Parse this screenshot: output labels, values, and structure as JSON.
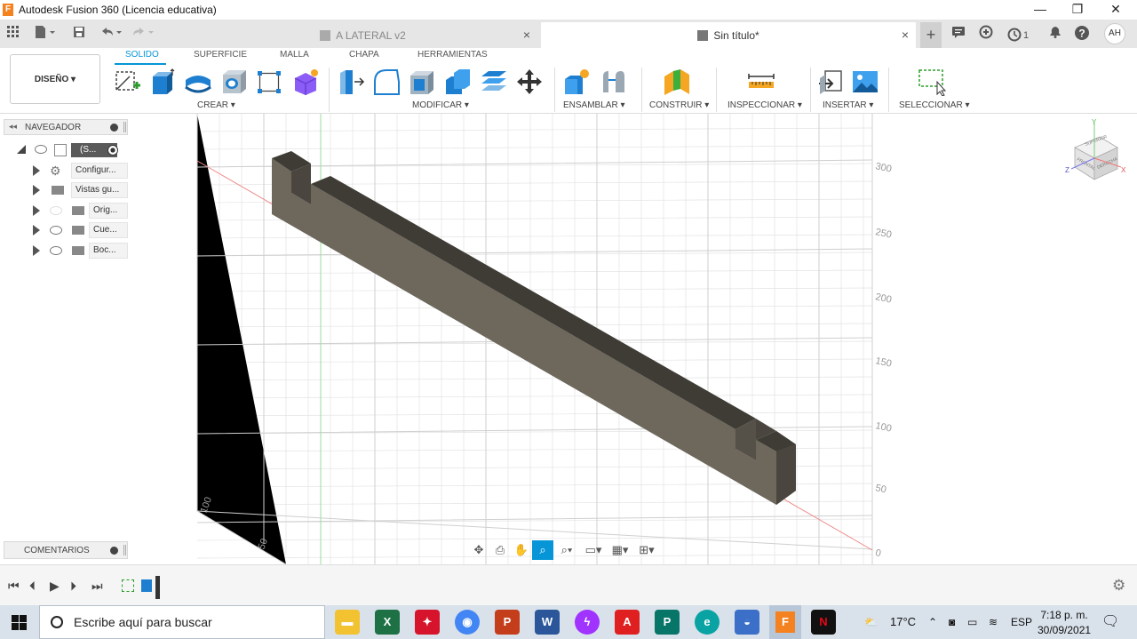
{
  "window": {
    "title": "Autodesk Fusion 360 (Licencia educativa)",
    "minimize": "—",
    "restore": "❐",
    "close": "✕"
  },
  "tabs": {
    "inactive_label": "A LATERAL v2",
    "active_label": "Sin título*",
    "close": "×"
  },
  "header_right": {
    "jobs_count": "1",
    "avatar": "AH"
  },
  "ribbon": {
    "workspace": "DISEÑO ▾",
    "tabs": [
      "SOLIDO",
      "SUPERFICIE",
      "MALLA",
      "CHAPA",
      "HERRAMIENTAS"
    ],
    "groups": [
      "CREAR ▾",
      "MODIFICAR ▾",
      "ENSAMBLAR ▾",
      "CONSTRUIR ▾",
      "INSPECCIONAR ▾",
      "INSERTAR ▾",
      "SELECCIONAR ▾"
    ]
  },
  "navigator": {
    "title": "NAVEGADOR",
    "root_label": "(S...",
    "items": [
      "Configur...",
      "Vistas gu...",
      "Orig...",
      "Cue...",
      "Boc..."
    ]
  },
  "comments": {
    "title": "COMENTARIOS"
  },
  "viewport": {
    "ruler_right": [
      "300",
      "250",
      "200",
      "150",
      "100",
      "50",
      "0"
    ],
    "ruler_bottom": [
      "100",
      "50"
    ],
    "viewcube_labels": [
      "SUPERIOR",
      "FRONTAL",
      "DERECHA"
    ],
    "axes": [
      "Y",
      "Z",
      "X"
    ],
    "colors": {
      "body_side": "#6d675c",
      "body_top": "#3f3c36",
      "body_end": "#4a463f"
    }
  },
  "taskbar": {
    "search_placeholder": "Escribe aquí para buscar",
    "temperature": "17°C",
    "language": "ESP",
    "time": "7:18 p. m.",
    "date": "30/09/2021"
  }
}
